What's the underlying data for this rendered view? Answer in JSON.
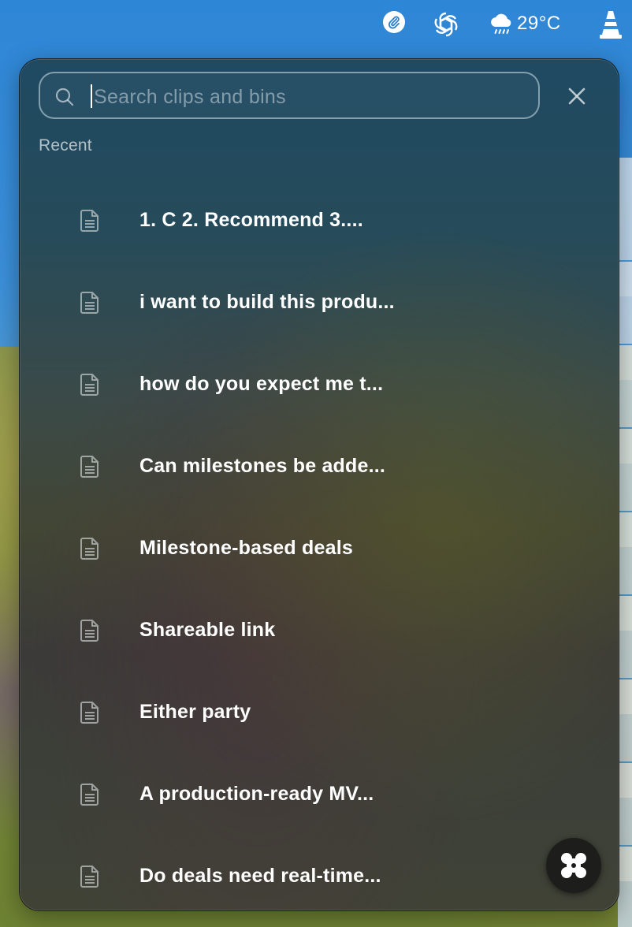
{
  "menubar": {
    "weather_temp": "29°C",
    "icons": [
      "clipboard-clip-icon",
      "openai-icon",
      "rain-cloud-icon",
      "vlc-cone-icon"
    ]
  },
  "search": {
    "placeholder": "Search clips and bins",
    "value": ""
  },
  "section": {
    "recent_label": "Recent"
  },
  "clips": [
    {
      "label": "1. C 2. Recommend 3...."
    },
    {
      "label": "i want to build this produ..."
    },
    {
      "label": "how do you expect me t..."
    },
    {
      "label": "Can milestones be adde..."
    },
    {
      "label": "Milestone-based deals"
    },
    {
      "label": "Shareable link"
    },
    {
      "label": "Either party"
    },
    {
      "label": "A production-ready MV..."
    },
    {
      "label": "Do deals need real-time..."
    }
  ],
  "colors": {
    "text_primary": "#ffffff",
    "text_secondary": "#d7dee4",
    "fab_bg": "#1d1d1b"
  }
}
